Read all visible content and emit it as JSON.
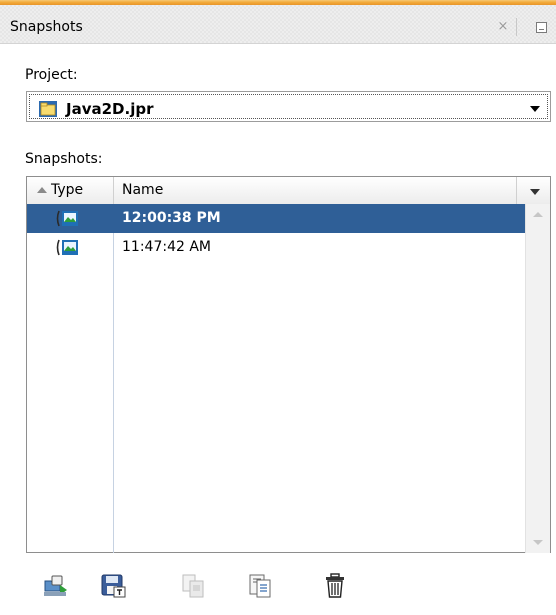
{
  "panel": {
    "title": "Snapshots",
    "close_symbol": "×"
  },
  "project": {
    "label": "Project:",
    "selected": "Java2D.jpr",
    "icon": "project-folder-icon"
  },
  "snapshots": {
    "label": "Snapshots:",
    "columns": {
      "type": "Type",
      "name": "Name"
    },
    "rows": [
      {
        "name": "12:00:38 PM",
        "icon": "snapshot-icon",
        "selected": true
      },
      {
        "name": "11:47:42 AM",
        "icon": "snapshot-icon",
        "selected": false
      }
    ]
  },
  "toolbar": {
    "buttons": [
      {
        "icon": "open-snapshot-icon",
        "enabled": true
      },
      {
        "icon": "save-snapshot-icon",
        "enabled": true
      },
      {
        "icon": "compare-snapshots-icon",
        "enabled": false
      },
      {
        "icon": "snapshot-details-icon",
        "enabled": true
      },
      {
        "icon": "delete-snapshot-icon",
        "enabled": true
      }
    ]
  },
  "colors": {
    "accent": "#f3ab3b",
    "selection": "#2f5f97",
    "selection_text": "#ffffff"
  }
}
